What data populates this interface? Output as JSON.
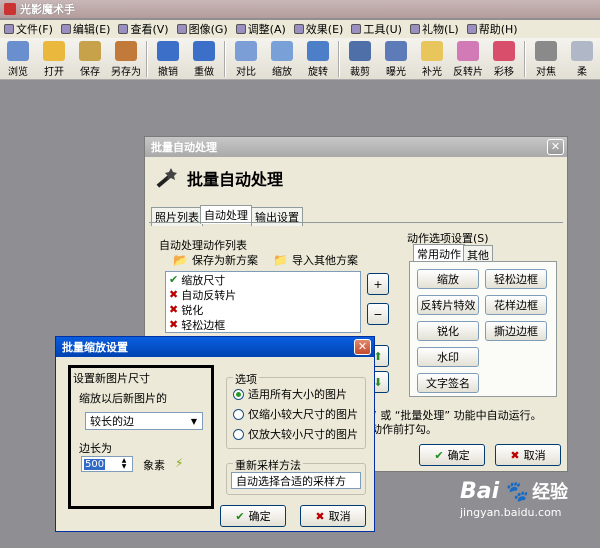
{
  "app": {
    "title": "光影魔术手"
  },
  "menu": [
    {
      "label": "文件(F)",
      "icon": "file-icon"
    },
    {
      "label": "编辑(E)",
      "icon": "edit-icon"
    },
    {
      "label": "查看(V)",
      "icon": "view-icon"
    },
    {
      "label": "图像(G)",
      "icon": "image-icon"
    },
    {
      "label": "调整(A)",
      "icon": "adjust-icon"
    },
    {
      "label": "效果(E)",
      "icon": "effect-icon"
    },
    {
      "label": "工具(U)",
      "icon": "tools-icon"
    },
    {
      "label": "礼物(L)",
      "icon": "gift-icon"
    },
    {
      "label": "帮助(H)",
      "icon": "help-icon"
    }
  ],
  "toolbar": [
    {
      "label": "浏览",
      "icon": "browse-icon",
      "color": "#6a8fcf"
    },
    {
      "label": "打开",
      "icon": "open-folder-icon",
      "color": "#e9b83c"
    },
    {
      "label": "保存",
      "icon": "save-icon",
      "color": "#c8a24a"
    },
    {
      "label": "另存为",
      "icon": "save-as-icon",
      "color": "#c27a3a"
    },
    {
      "label": "撤销",
      "icon": "undo-icon",
      "color": "#3c6fc7"
    },
    {
      "label": "重做",
      "icon": "redo-icon",
      "color": "#3c6fc7"
    },
    {
      "label": "对比",
      "icon": "compare-icon",
      "color": "#7b9ed6"
    },
    {
      "label": "缩放",
      "icon": "resize-icon",
      "color": "#7aa0d8"
    },
    {
      "label": "旋转",
      "icon": "rotate-icon",
      "color": "#4d7fc9"
    },
    {
      "label": "裁剪",
      "icon": "crop-icon",
      "color": "#4f6fa8"
    },
    {
      "label": "曝光",
      "icon": "exposure-icon",
      "color": "#5d7bb8"
    },
    {
      "label": "补光",
      "icon": "fill-light-icon",
      "color": "#e8c65c"
    },
    {
      "label": "反转片",
      "icon": "reversal-film-icon",
      "color": "#d27ab5"
    },
    {
      "label": "彩移",
      "icon": "color-shift-icon",
      "color": "#d94e6b"
    },
    {
      "label": "对焦",
      "icon": "focus-icon",
      "color": "#8a8a8a"
    },
    {
      "label": "柔",
      "icon": "soft-icon",
      "color": "#b0b8c8"
    }
  ],
  "batch": {
    "title": "批量自动处理",
    "heading": "批量自动处理",
    "tabs": [
      "照片列表",
      "自动处理",
      "输出设置"
    ],
    "actions_group": "自动处理动作列表",
    "save_scheme": "保存为新方案",
    "import_scheme": "导入其他方案",
    "actions": [
      {
        "label": "缩放尺寸",
        "state": "check"
      },
      {
        "label": "自动反转片",
        "state": "cross"
      },
      {
        "label": "锐化",
        "state": "cross"
      },
      {
        "label": "轻松边框",
        "state": "cross"
      }
    ],
    "side_buttons": [
      "+",
      "−",
      "⬆",
      "⬇"
    ],
    "options_group": "动作选项设置(S)",
    "option_tabs": [
      "常用动作",
      "其他"
    ],
    "option_buttons": [
      "缩放",
      "轻松边框",
      "反转片特效",
      "花样边框",
      "锐化",
      "撕边边框",
      "水印",
      "文字签名"
    ],
    "note_line1": "” 或 “批量处理” 功能中自动运行。",
    "note_line2": "动作前打勾。",
    "ok": "确定",
    "cancel": "取消"
  },
  "resize": {
    "title": "批量缩放设置",
    "size_group": "设置新图片尺寸",
    "size_prompt": "缩放以后新图片的",
    "edge_select": "较长的边",
    "edge_label": "边长为",
    "edge_value": "500",
    "unit": "象素",
    "options_group": "选项",
    "radios": [
      {
        "label": "适用所有大小的图片",
        "on": true
      },
      {
        "label": "仅缩小较大尺寸的图片",
        "on": false
      },
      {
        "label": "仅放大较小尺寸的图片",
        "on": false
      }
    ],
    "resample_group": "重新采样方法",
    "resample_value": "自动选择合适的采样方",
    "ok": "确定",
    "cancel": "取消"
  },
  "watermark": {
    "logo": "Bai",
    "logo_text": "经验",
    "url": "jingyan.baidu.com"
  }
}
